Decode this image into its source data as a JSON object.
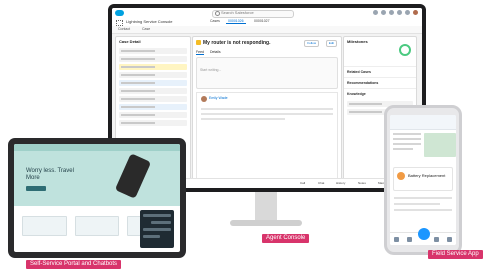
{
  "monitor": {
    "search_placeholder": "Search Salesforce",
    "app_name": "Lightning Service Console",
    "tabs": [
      "Cases",
      "00001026",
      "00001027"
    ],
    "subtabs": [
      "Contact",
      "Case"
    ],
    "left_panel_title": "Case Detail",
    "case_title": "My router is not responding.",
    "follow_label": "Follow",
    "edit_label": "Edit",
    "mid_tabs": [
      "Feed",
      "Details"
    ],
    "composer_placeholder": "Start writing...",
    "feed_author": "Emily Wade",
    "right_panel_title": "Milestones",
    "right_sections": [
      "Related Cases",
      "Recommendations",
      "Knowledge"
    ],
    "footer_items": [
      "Call",
      "Chat",
      "History",
      "Notes",
      "Macros"
    ]
  },
  "tablet": {
    "hero_text": "Worry less. Travel More"
  },
  "phone": {
    "card_title": "Battery Replacement"
  },
  "captions": {
    "agent_console": "Agent Console",
    "field_service": "Field Service App",
    "self_service": "Self-Service Portal and Chatbots"
  },
  "colors": {
    "caption_bg": "#d8346b",
    "accent": "#0070d2",
    "brand_cloud": "#00a1e0"
  }
}
